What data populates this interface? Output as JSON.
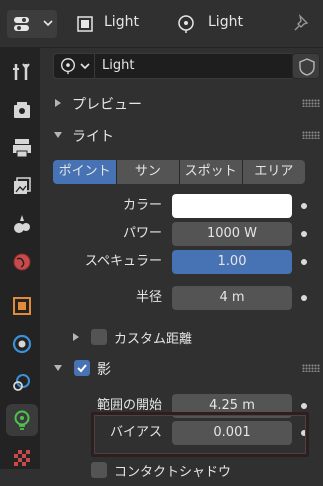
{
  "header": {
    "object_name": "Light",
    "data_name": "Light"
  },
  "datablock": {
    "name": "Light"
  },
  "panels": {
    "preview": "プレビュー",
    "light": "ライト",
    "custom_distance": "カスタム距離",
    "shadow": "影",
    "contact_shadow": "コンタクトシャドウ"
  },
  "light_types": [
    "ポイント",
    "サン",
    "スポット",
    "エリア"
  ],
  "properties": {
    "color_label": "カラー",
    "color_value": "#ffffff",
    "power_label": "パワー",
    "power_value": "1000 W",
    "specular_label": "スペキュラー",
    "specular_value": "1.00",
    "radius_label": "半径",
    "radius_value": "4 m",
    "clip_start_label": "範囲の開始",
    "clip_start_value": "4.25 m",
    "bias_label": "バイアス",
    "bias_value": "0.001"
  },
  "colors": {
    "accent": "#4772b3",
    "light_active": "#4ec44e"
  }
}
